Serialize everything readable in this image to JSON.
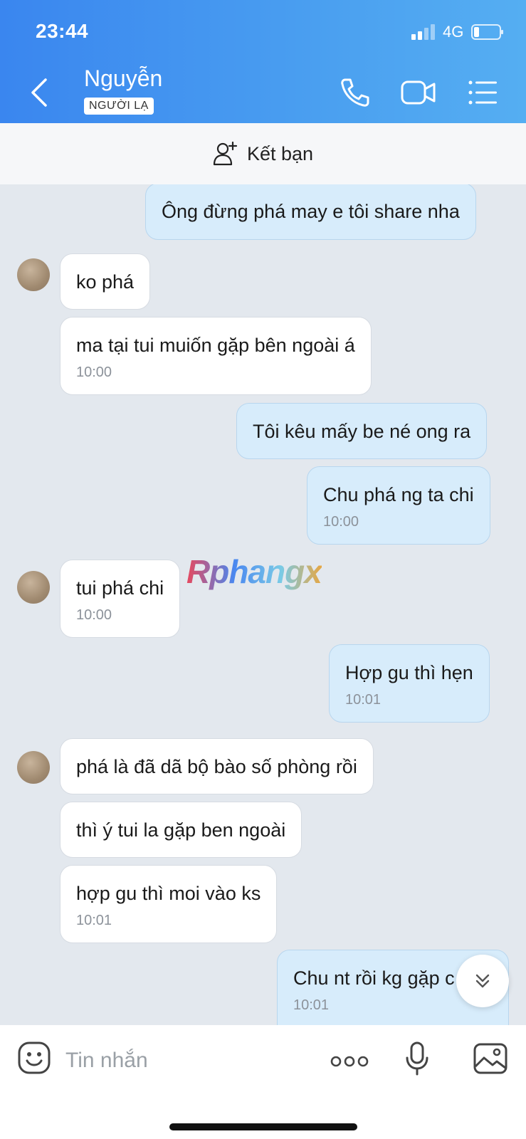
{
  "status_bar": {
    "time": "23:44",
    "network": "4G"
  },
  "header": {
    "contact_name": "Nguyễn",
    "badge": "NGƯỜI LẠ"
  },
  "add_friend": {
    "label": "Kết bạn"
  },
  "messages": [
    {
      "direction": "out",
      "text": "Ông đừng phá may e tôi share nha",
      "time": null
    },
    {
      "direction": "in",
      "text": "ko phá",
      "time": null
    },
    {
      "direction": "in",
      "text": "ma tại tui muiốn gặp bên ngoài á",
      "time": "10:00"
    },
    {
      "direction": "out",
      "text": "Tôi kêu mấy be né ong ra",
      "time": null
    },
    {
      "direction": "out",
      "text": "Chu phá ng ta chi",
      "time": "10:00"
    },
    {
      "direction": "in",
      "text": "tui phá chi",
      "time": "10:00"
    },
    {
      "direction": "out",
      "text": "Hợp gu thì hẹn",
      "time": "10:01"
    },
    {
      "direction": "in",
      "text": "phá là đã dã bộ bào số phòng rồi",
      "time": null
    },
    {
      "direction": "in",
      "text": "thì ý tui la gặp ben ngoài",
      "time": null
    },
    {
      "direction": "in",
      "text": "hợp gu thì moi vào ks",
      "time": "10:01"
    },
    {
      "direction": "out",
      "text": "Chu nt rồi kg gặp c",
      "time": "10:01"
    }
  ],
  "watermark": "Rphangx",
  "input": {
    "placeholder": "Tin nhắn"
  },
  "colors": {
    "header": "#3a86ef",
    "outgoing_bubble": "#d7ecfb",
    "incoming_bubble": "#ffffff",
    "chat_background": "#e3e8ee"
  },
  "icons": [
    "back-icon",
    "phone-icon",
    "video-call-icon",
    "menu-icon",
    "add-friend-icon",
    "scroll-down-icon",
    "emoji-icon",
    "more-icon",
    "mic-icon",
    "image-icon"
  ]
}
